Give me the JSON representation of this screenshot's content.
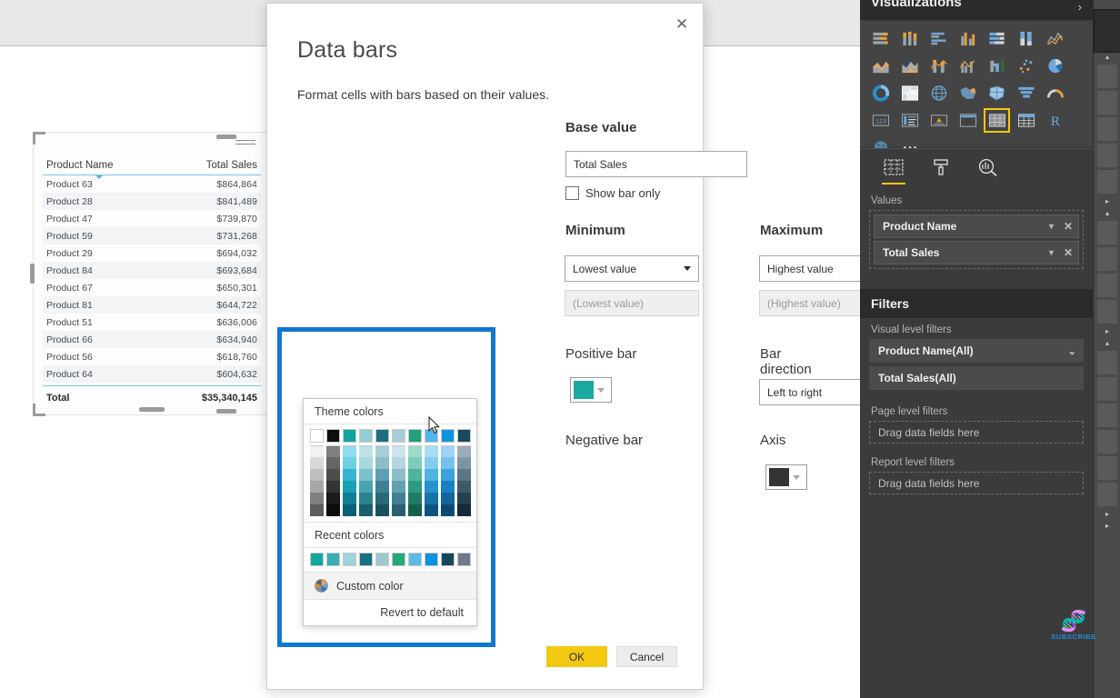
{
  "dialog": {
    "title": "Data bars",
    "subtitle": "Format cells with bars based on their values.",
    "close_icon": "close-icon",
    "base_value_label": "Base value",
    "base_value": "Total Sales",
    "show_bar_only_label": "Show bar only",
    "minimum_label": "Minimum",
    "minimum_value": "Lowest value",
    "minimum_input_placeholder": "(Lowest value)",
    "maximum_label": "Maximum",
    "maximum_value": "Highest value",
    "maximum_input_placeholder": "(Highest value)",
    "positive_bar_label": "Positive bar",
    "positive_bar_color": "#1ba9a0",
    "negative_bar_label": "Negative bar",
    "bar_direction_label": "Bar direction",
    "bar_direction_value": "Left to right",
    "axis_label": "Axis",
    "axis_color": "#333333",
    "ok_label": "OK",
    "cancel_label": "Cancel",
    "ok_color": "#f2c811"
  },
  "color_picker": {
    "theme_header": "Theme colors",
    "recent_header": "Recent colors",
    "custom_label": "Custom color",
    "revert_label": "Revert to default",
    "theme_base": [
      "#ffffff",
      "#0d0d0d",
      "#12a5a0",
      "#93cdd2",
      "#1a6e80",
      "#a7ccd9",
      "#22a07a",
      "#52b5e8",
      "#0f92e0",
      "#174a5e"
    ],
    "theme_shades": [
      [
        "#f2f2f2",
        "#d9d9d9",
        "#bfbfbf",
        "#a6a6a6",
        "#808080",
        "#5c5c5c"
      ],
      [
        "#808080",
        "#666666",
        "#4d4d4d",
        "#333333",
        "#1a1a1a",
        "#0d0d0d"
      ],
      [
        "#8fdcef",
        "#6fcfe3",
        "#35b5cf",
        "#18a1b4",
        "#0d7f93",
        "#0a5f72"
      ],
      [
        "#bde3e8",
        "#a7d8de",
        "#7cc2cb",
        "#4aa3ae",
        "#2c8390",
        "#1a5f6b"
      ],
      [
        "#a9cdd8",
        "#8ebcca",
        "#5e9fb3",
        "#3d8097",
        "#286878",
        "#19505f"
      ],
      [
        "#cfe3ea",
        "#b5d5df",
        "#8dbccb",
        "#649fb2",
        "#437f93",
        "#2a5f72"
      ],
      [
        "#9fd9cb",
        "#7ecbb8",
        "#4fb49b",
        "#2d9a80",
        "#1f7b66",
        "#15604f"
      ],
      [
        "#a8dcf2",
        "#85cdee",
        "#4fb3e2",
        "#2493cd",
        "#1573a8",
        "#0d5580"
      ],
      [
        "#9ed4f2",
        "#74c1ec",
        "#3ba2dd",
        "#1a82c2",
        "#11659b",
        "#0a4a73"
      ],
      [
        "#9aacb8",
        "#7d94a3",
        "#5a7687",
        "#3d5a6b",
        "#27404f",
        "#172b36"
      ]
    ],
    "recent": [
      "#14a79d",
      "#39b0b8",
      "#9dd3d9",
      "#17707f",
      "#9fc7d2",
      "#23a97e",
      "#5bbbe8",
      "#0f92e0",
      "#16455c",
      "#6e7a8a"
    ]
  },
  "table_visual": {
    "columns": [
      "Product Name",
      "Total Sales"
    ],
    "rows": [
      {
        "name": "Product 63",
        "value": "$864,864"
      },
      {
        "name": "Product 28",
        "value": "$841,489"
      },
      {
        "name": "Product 47",
        "value": "$739,870"
      },
      {
        "name": "Product 59",
        "value": "$731,268"
      },
      {
        "name": "Product 29",
        "value": "$694,032"
      },
      {
        "name": "Product 84",
        "value": "$693,684"
      },
      {
        "name": "Product 67",
        "value": "$650,301"
      },
      {
        "name": "Product 81",
        "value": "$644,722"
      },
      {
        "name": "Product 51",
        "value": "$636,006"
      },
      {
        "name": "Product 66",
        "value": "$634,940"
      },
      {
        "name": "Product 56",
        "value": "$618,760"
      },
      {
        "name": "Product 64",
        "value": "$604,632"
      }
    ],
    "total_label": "Total",
    "total_value": "$35,340,145"
  },
  "right_panel": {
    "title": "Visualizations",
    "gallery": [
      [
        "stacked-bar-chart",
        "stacked-column-chart",
        "clustered-bar-chart",
        "clustered-column-chart",
        "100-stacked-bar-chart",
        "100-stacked-column-chart",
        "line-chart"
      ],
      [
        "area-chart",
        "stacked-area-chart",
        "line-stacked-column-chart",
        "line-clustered-column-chart",
        "ribbon-chart",
        "scatter-chart",
        "pie-chart"
      ],
      [
        "donut-chart",
        "treemap-chart",
        "map-chart",
        "filled-map-chart",
        "shape-map-chart",
        "funnel-chart",
        "gauge-chart"
      ],
      [
        "card-visual",
        "multi-row-card",
        "kpi-visual",
        "slicer-visual",
        "table-visual",
        "matrix-visual",
        "r-script-visual"
      ],
      [
        "python-visual",
        "more-visuals-icon"
      ]
    ],
    "selected_gallery_icon": "table-visual",
    "tabs": [
      "fields-tab",
      "format-tab",
      "analytics-tab"
    ],
    "active_tab": "fields-tab",
    "values_label": "Values",
    "values": [
      "Product Name",
      "Total Sales"
    ],
    "filters_title": "Filters",
    "visual_level_label": "Visual level filters",
    "visual_filters": [
      "Product Name(All)",
      "Total Sales(All)"
    ],
    "page_level_label": "Page level filters",
    "page_level_placeholder": "Drag data fields here",
    "report_level_label": "Report level filters",
    "report_level_placeholder": "Drag data fields here"
  },
  "watermark": {
    "label": "SUBSCRIBE",
    "icon": "dna-icon",
    "color": "#1f8fe0"
  }
}
